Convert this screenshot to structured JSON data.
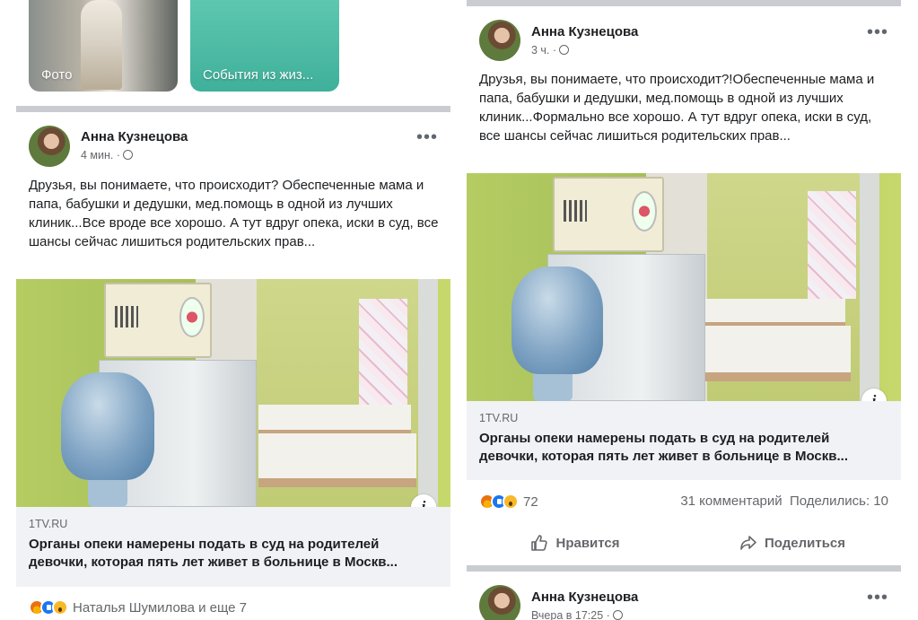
{
  "left": {
    "tiles": [
      {
        "label": "Фото"
      },
      {
        "label": "События из жиз..."
      }
    ],
    "post": {
      "author": "Анна Кузнецова",
      "time": "4 мин. ·",
      "text": "Друзья, вы понимаете, что происходит? Обеспеченные мама и папа, бабушки и дедушки, мед.помощь в одной из лучших клиник...Все вроде все хорошо. А тут вдруг опека, иски в суд, все шансы сейчас лишиться родительских прав...",
      "link_domain": "1TV.RU",
      "link_title": "Органы опеки намерены подать в суд на родителей девочки, которая пять лет живет в больнице в Москв...",
      "reactions_text": "Наталья Шумилова и еще 7"
    }
  },
  "right": {
    "post": {
      "author": "Анна Кузнецова",
      "time": "3 ч. ·",
      "text": "Друзья, вы понимаете, что происходит?!Обеспеченные мама и папа, бабушки и дедушки, мед.помощь в одной из лучших клиник...Формально все хорошо. А тут вдруг опека, иски в суд, все шансы сейчас лишиться родительских прав...",
      "link_domain": "1TV.RU",
      "link_title": "Органы опеки намерены подать в суд на родителей девочки, которая пять лет живет в больнице в Москв...",
      "reactions_count": "72",
      "comments": "31 комментарий",
      "shares": "Поделились: 10",
      "like_label": "Нравится",
      "share_label": "Поделиться"
    },
    "next_post": {
      "author": "Анна Кузнецова",
      "time": "Вчера в 17:25 ·"
    }
  },
  "more_icon": "•••",
  "info_icon": "i",
  "colors": {
    "separator": "#c9ccd1",
    "link_box_bg": "#f0f2f5",
    "secondary_text": "#65676b",
    "like_blue": "#1877f2",
    "life_events_tile": "#4fbca4"
  }
}
